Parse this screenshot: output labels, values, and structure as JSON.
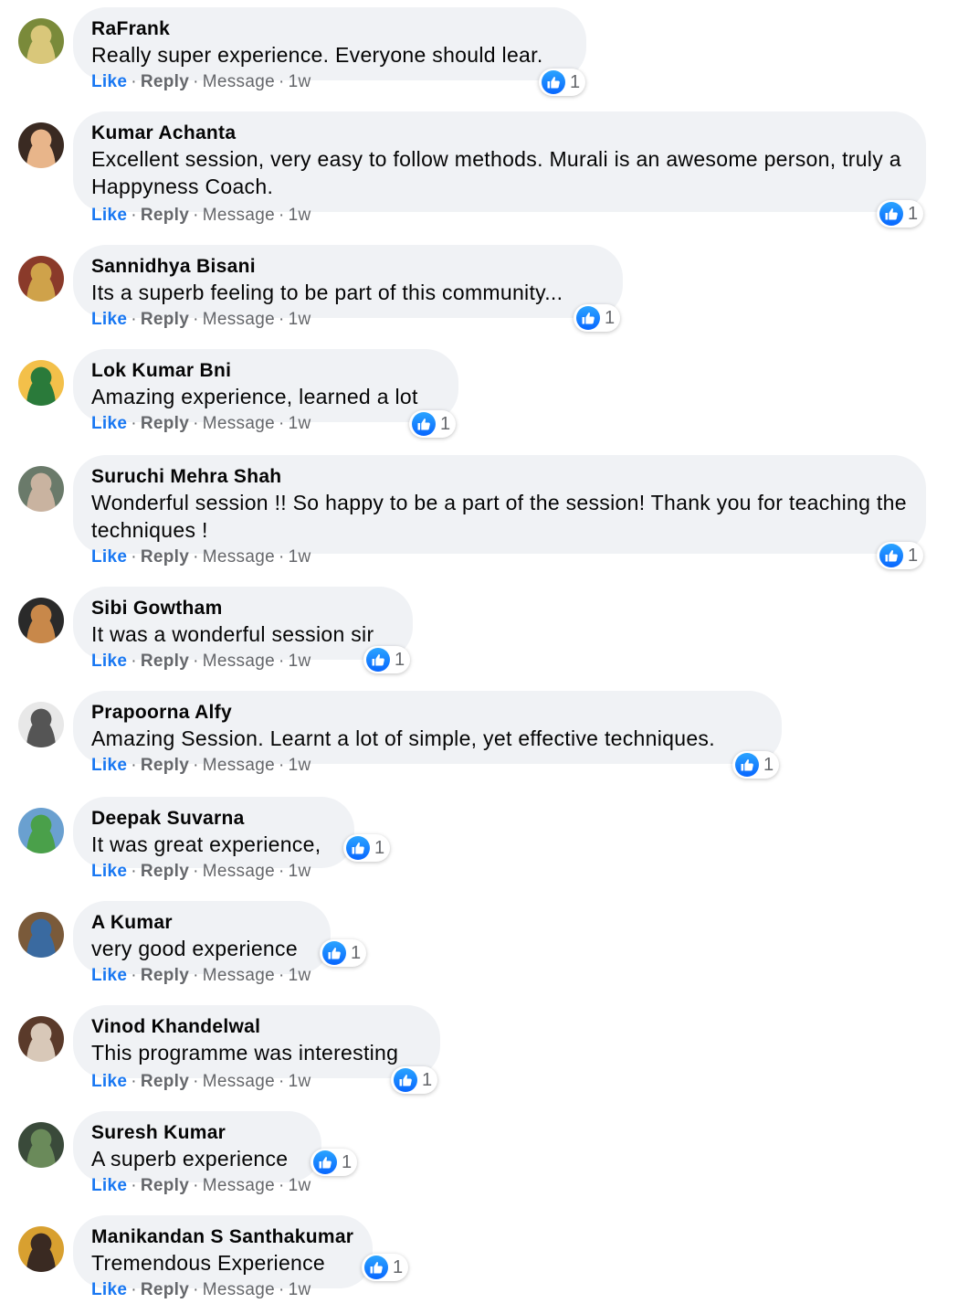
{
  "colors": {
    "like_blue": "#1877f2",
    "bubble_bg": "#f0f2f5",
    "meta_gray": "#65676b"
  },
  "icons": {
    "reaction": "thumbs-up-icon"
  },
  "actions": {
    "like": "Like",
    "reply": "Reply",
    "message": "Message",
    "separator": "·"
  },
  "comments": [
    {
      "name": "RaFrank",
      "text": "Really super experience. Everyone should lear.",
      "reactions": "1",
      "time": "1w"
    },
    {
      "name": "Kumar Achanta",
      "text": "Excellent session, very easy to follow methods. Murali is an awesome person, truly a Happyness Coach.",
      "reactions": "1",
      "time": "1w"
    },
    {
      "name": "Sannidhya Bisani",
      "text": "Its a superb feeling to be part of this community...",
      "reactions": "1",
      "time": "1w"
    },
    {
      "name": "Lok Kumar Bni",
      "text": "Amazing experience, learned a lot",
      "reactions": "1",
      "time": "1w"
    },
    {
      "name": "Suruchi Mehra Shah",
      "text": "Wonderful session !! So happy to be a part of the session! Thank you for teaching the techniques !",
      "reactions": "1",
      "time": "1w"
    },
    {
      "name": "Sibi Gowtham",
      "text": "It was a wonderful session sir",
      "reactions": "1",
      "time": "1w"
    },
    {
      "name": "Prapoorna Alfy",
      "text": "Amazing Session. Learnt a lot of simple, yet effective techniques.",
      "reactions": "1",
      "time": "1w"
    },
    {
      "name": "Deepak Suvarna",
      "text": "It was great experience,",
      "reactions": "1",
      "time": "1w"
    },
    {
      "name": "A Kumar",
      "text": "very good experience",
      "reactions": "1",
      "time": "1w"
    },
    {
      "name": "Vinod Khandelwal",
      "text": "This programme was interesting",
      "reactions": "1",
      "time": "1w"
    },
    {
      "name": "Suresh Kumar",
      "text": "A superb experience",
      "reactions": "1",
      "time": "1w"
    },
    {
      "name": "Manikandan S Santhakumar",
      "text": "Tremendous Experience",
      "reactions": "1",
      "time": "1w"
    }
  ]
}
